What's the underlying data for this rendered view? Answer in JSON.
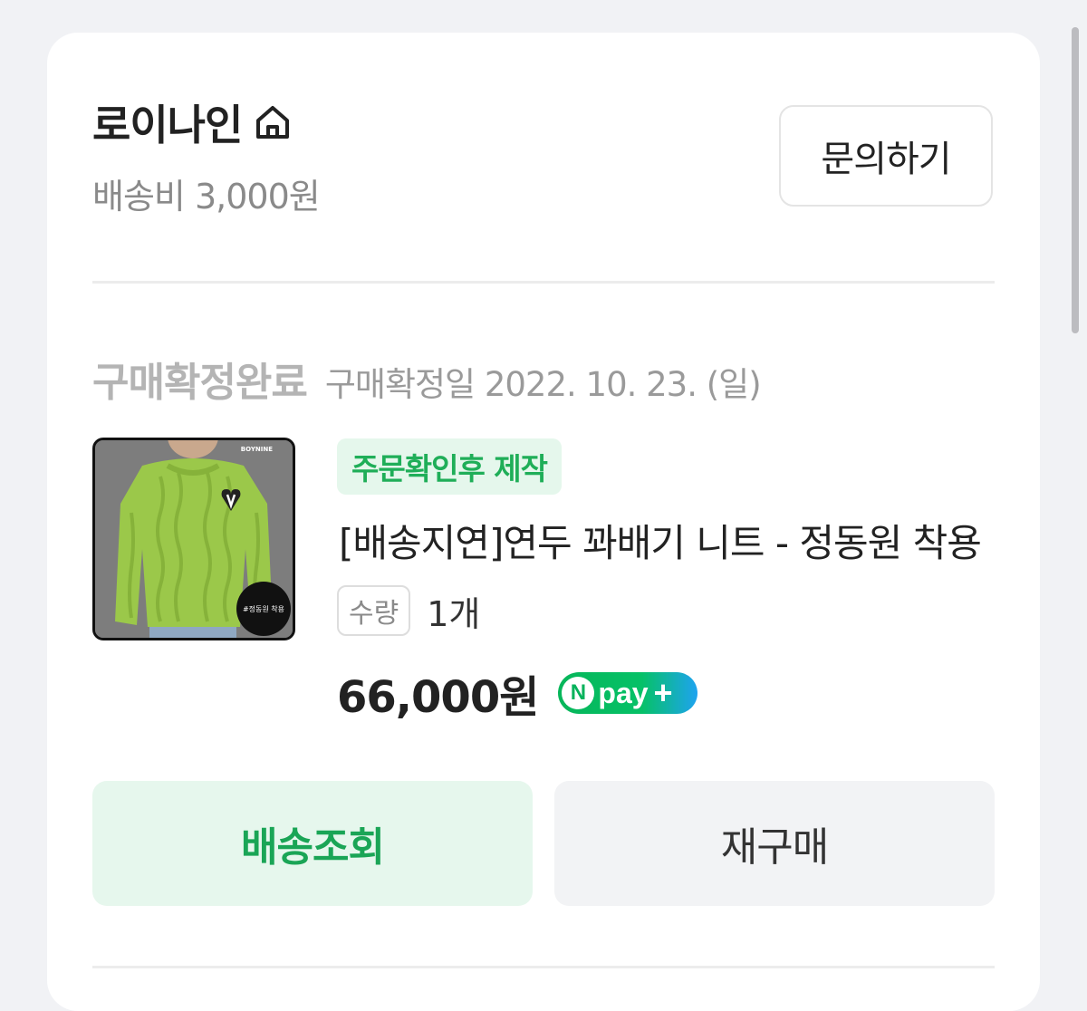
{
  "seller": {
    "name": "로이나인",
    "icon": "home-icon",
    "shipping_fee": "배송비 3,000원"
  },
  "actions": {
    "inquiry_label": "문의하기",
    "track_label": "배송조회",
    "rebuy_label": "재구매"
  },
  "order": {
    "status": "구매확정완료",
    "confirm_date": "구매확정일 2022. 10. 23. (일)"
  },
  "product": {
    "badge": "주문확인후 제작",
    "name": "[배송지연]연두 꽈배기 니트 - 정동원 착용",
    "quantity_label": "수량",
    "quantity_value": "1개",
    "price": "66,000원",
    "thumbnail": {
      "brand_text": "BOYNINE",
      "tag_text": "#정동원 착용"
    },
    "pay_badge": {
      "n": "N",
      "text": "pay",
      "plus": "+"
    }
  },
  "colors": {
    "accent_green": "#1aa556",
    "badge_bg": "#e5f7ec",
    "status_gray": "#b4b4b4"
  }
}
